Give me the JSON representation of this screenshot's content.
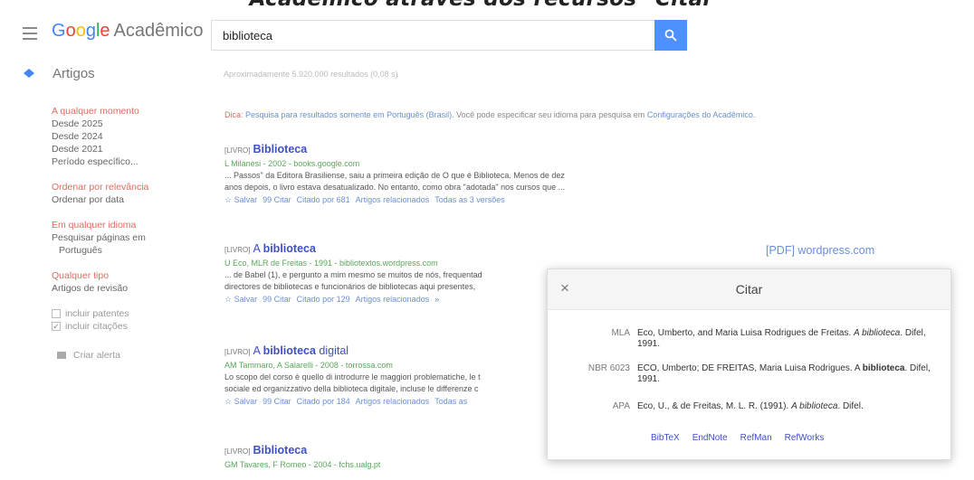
{
  "banner": "Acadêmico através dos recursos \"Citar\"",
  "header": {
    "logo_google": [
      "G",
      "o",
      "o",
      "g",
      "l",
      "e"
    ],
    "logo_suffix": "Acadêmico",
    "search_value": "biblioteca"
  },
  "subbar": {
    "articles_label": "Artigos",
    "result_count": "Aproximadamente 5.920.000 resultados (0,08 s)"
  },
  "sidebar": {
    "time": [
      "A qualquer momento",
      "Desde 2025",
      "Desde 2024",
      "Desde 2021",
      "Período específico..."
    ],
    "sort": [
      "Ordenar por relevância",
      "Ordenar por data"
    ],
    "lang": [
      "Em qualquer idioma",
      "Pesquisar páginas em",
      "Português"
    ],
    "type": [
      "Qualquer tipo",
      "Artigos de revisão"
    ],
    "include_patents": "incluir patentes",
    "include_citations": "incluir citações",
    "create_alert": "Criar alerta"
  },
  "tip": {
    "label": "Dica:",
    "link": "Pesquisa para resultados somente em Português (Brasil)",
    "text": ". Você pode especificar seu idioma para pesquisa em",
    "link2": "Configurações do Acadêmico",
    "end": "."
  },
  "results": [
    {
      "tag": "[LIVRO]",
      "title_plain": "",
      "title_bold": "Biblioteca",
      "title_after": "",
      "meta": "L Milanesi - 2002 - books.google.com",
      "snippet1": "... Passos\" da Editora Brasiliense, saiu a primeira edição de O que é Biblioteca. Menos de dez",
      "snippet2": "anos depois, o livro estava desatualizado. No entanto, como obra \"adotada\" nos cursos que ...",
      "links": [
        "☆ Salvar",
        "99 Citar",
        "Citado por 681",
        "Artigos relacionados",
        "Todas as 3 versões"
      ]
    },
    {
      "tag": "[LIVRO]",
      "title_plain": "A ",
      "title_bold": "biblioteca",
      "title_after": "",
      "meta": "U Eco, MLR de Freitas - 1991 - bibliotextos.wordpress.com",
      "snippet1": "... de Babel (1), e pergunto a mim mesmo se muitos de nós, frequentad",
      "snippet2": "directores de bibliotecas e funcionários de bibliotecas aqui presentes,",
      "links": [
        "☆ Salvar",
        "99 Citar",
        "Citado por 129",
        "Artigos relacionados",
        "»"
      ]
    },
    {
      "tag": "[LIVRO]",
      "title_plain": "A ",
      "title_bold": "biblioteca",
      "title_after": " digital",
      "meta": "AM Tammaro, A Salarelli - 2008 - torrossa.com",
      "snippet1": "Lo scopo del corso è quello di introdurre le maggiori problematiche, le t",
      "snippet2": "sociale ed organizzativo della biblioteca digitale, incluse le differenze c",
      "links": [
        "☆ Salvar",
        "99 Citar",
        "Citado por 184",
        "Artigos relacionados",
        "Todas as"
      ]
    },
    {
      "tag": "[LIVRO]",
      "title_plain": "",
      "title_bold": "Biblioteca",
      "title_after": "",
      "meta": "GM Tavares, F Romeo - 2004 - fchs.ualg.pt",
      "snippet1": "",
      "snippet2": "",
      "links": []
    }
  ],
  "pdf_link": "[PDF] wordpress.com",
  "modal": {
    "close": "×",
    "title": "Citar",
    "citations": [
      {
        "label": "MLA",
        "pre": "Eco, Umberto, and Maria Luisa Rodrigues de Freitas. ",
        "ital": "A biblioteca",
        "post": ". Difel, 1991."
      },
      {
        "label": "NBR 6023",
        "pre": "ECO, Umberto; DE FREITAS, Maria Luisa Rodrigues. A ",
        "bold": "biblioteca",
        "post": ". Difel, 1991."
      },
      {
        "label": "APA",
        "pre": "Eco, U., & de Freitas, M. L. R. (1991). ",
        "ital": "A biblioteca",
        "post": ". Difel."
      }
    ],
    "exports": [
      "BibTeX",
      "EndNote",
      "RefMan",
      "RefWorks"
    ]
  },
  "colors": {
    "accent_blue": "#4d90fe",
    "link_blue": "#3f4fc4",
    "filter_red": "#e26a5e",
    "meta_green": "#5aa65a"
  }
}
